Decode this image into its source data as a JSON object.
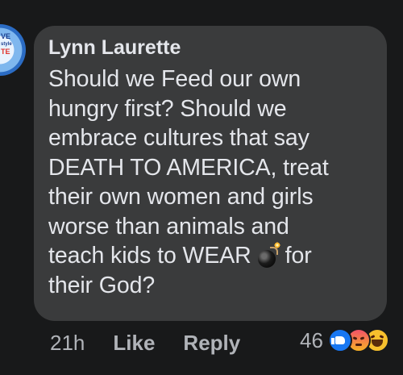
{
  "comment": {
    "author": "Lynn Laurette",
    "lines": [
      "Should we Feed our own",
      "hungry first?  Should we",
      "embrace cultures that say",
      "DEATH TO AMERICA, treat",
      "their own women and girls",
      "worse than animals and"
    ],
    "line7_before": "teach kids to WEAR",
    "line7_after": "for",
    "line8": "their God?",
    "inline_emoji": "bomb-icon"
  },
  "avatar": {
    "text_top": "VE",
    "text_mid": "style",
    "text_bot": "TE",
    "colors": [
      "#e9f3ff",
      "#7fb7ee",
      "#2b6cc4",
      "#e0322b"
    ]
  },
  "actions": {
    "time": "21h",
    "like_label": "Like",
    "reply_label": "Reply"
  },
  "reactions": {
    "count": "46",
    "types": [
      "like",
      "angry",
      "haha"
    ]
  },
  "colors": {
    "background": "#18191a",
    "bubble": "#3a3b3c",
    "text": "#e4e6eb",
    "secondary": "#b0b3b8",
    "like_blue": "#1877f2"
  }
}
